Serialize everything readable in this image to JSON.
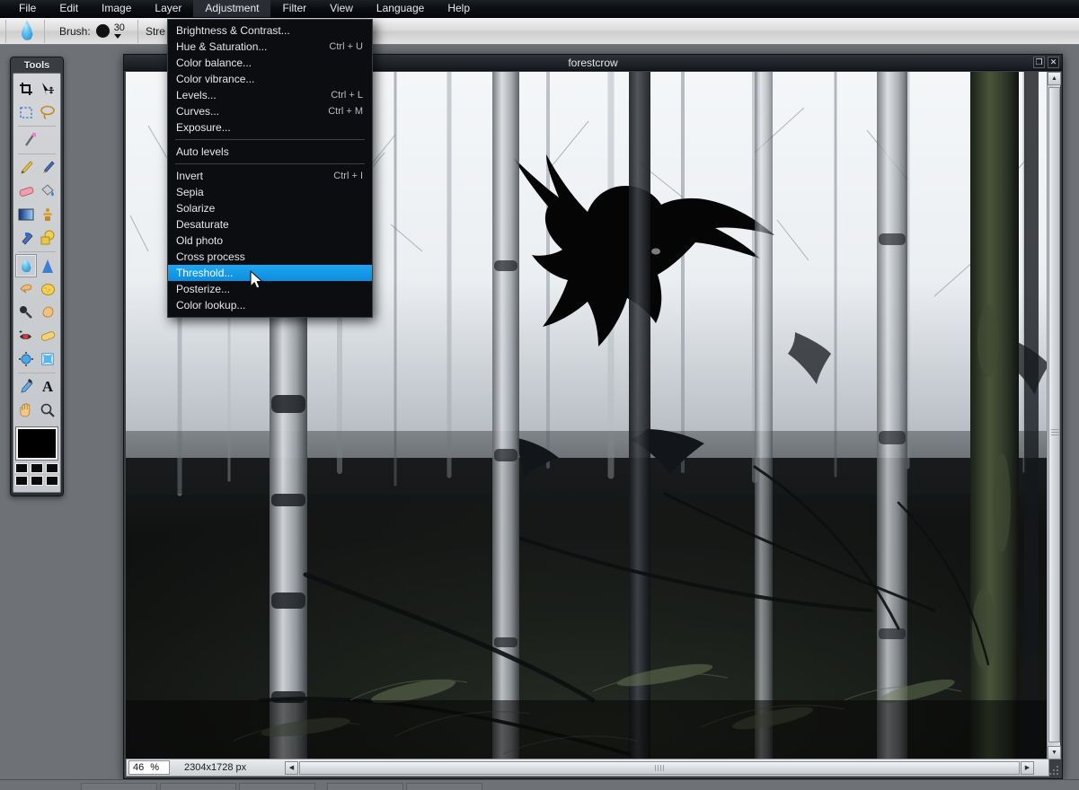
{
  "app": {
    "menubar": [
      {
        "label": "File",
        "open": false
      },
      {
        "label": "Edit",
        "open": false
      },
      {
        "label": "Image",
        "open": false
      },
      {
        "label": "Layer",
        "open": false
      },
      {
        "label": "Adjustment",
        "open": true
      },
      {
        "label": "Filter",
        "open": false
      },
      {
        "label": "View",
        "open": false
      },
      {
        "label": "Language",
        "open": false
      },
      {
        "label": "Help",
        "open": false
      }
    ]
  },
  "options_bar": {
    "active_tool_icon": "water-drop-icon",
    "brush_label": "Brush:",
    "brush_size": "30",
    "strength_label": "Stre"
  },
  "tools_panel": {
    "title": "Tools",
    "rows": [
      [
        {
          "name": "crop-tool",
          "glyph": "⌗"
        },
        {
          "name": "move-tool",
          "glyph": "➤"
        }
      ],
      [
        {
          "name": "rectangular-select-tool",
          "glyph": "▭"
        },
        {
          "name": "lasso-tool",
          "glyph": "◯"
        }
      ],
      [
        {
          "name": "magic-wand-tool",
          "glyph": "✦"
        }
      ],
      [
        {
          "name": "pencil-tool",
          "glyph": "✏"
        },
        {
          "name": "paintbrush-tool",
          "glyph": "🖌"
        }
      ],
      [
        {
          "name": "eraser-tool",
          "glyph": "▰"
        },
        {
          "name": "paint-bucket-tool",
          "glyph": "🪣"
        }
      ],
      [
        {
          "name": "gradient-tool",
          "glyph": "▤"
        },
        {
          "name": "clone-stamp-tool",
          "glyph": "♟"
        }
      ],
      [
        {
          "name": "smudge-tool",
          "glyph": "✒"
        },
        {
          "name": "shape-tool",
          "glyph": "⬟"
        }
      ],
      [
        {
          "name": "blur-tool",
          "glyph": "💧",
          "selected": true
        },
        {
          "name": "sharpen-tool",
          "glyph": "▲"
        }
      ],
      [
        {
          "name": "dodge-tool",
          "glyph": "☞"
        },
        {
          "name": "sponge-tool",
          "glyph": "⬤"
        }
      ],
      [
        {
          "name": "burn-tool",
          "glyph": "🔍"
        },
        {
          "name": "pinch-tool",
          "glyph": "✋"
        }
      ],
      [
        {
          "name": "red-eye-tool",
          "glyph": "◉"
        },
        {
          "name": "bandage-tool",
          "glyph": "▬"
        }
      ],
      [
        {
          "name": "bloat-tool",
          "glyph": "✥"
        },
        {
          "name": "warp-tool",
          "glyph": "✧"
        }
      ],
      [
        {
          "name": "eyedropper-tool",
          "glyph": "✎"
        },
        {
          "name": "text-tool",
          "glyph": "A"
        }
      ],
      [
        {
          "name": "hand-tool",
          "glyph": "✋"
        },
        {
          "name": "zoom-tool",
          "glyph": "🔎"
        }
      ]
    ],
    "foreground_color": "#000000",
    "palette_colors": [
      "#0a0a0a",
      "#0a0a0a",
      "#0a0a0a",
      "#0a0a0a",
      "#0a0a0a",
      "#0a0a0a"
    ]
  },
  "document_window": {
    "title": "forestcrow",
    "maximize_label": "❐",
    "close_label": "✕",
    "status": {
      "zoom_value": "46",
      "zoom_unit": "%",
      "dimensions": "2304x1728 px"
    }
  },
  "adjustment_menu": {
    "items": [
      {
        "label": "Brightness & Contrast...",
        "accel": "",
        "highlighted": false,
        "separator_after": false
      },
      {
        "label": "Hue & Saturation...",
        "accel": "Ctrl + U",
        "highlighted": false,
        "separator_after": false
      },
      {
        "label": "Color balance...",
        "accel": "",
        "highlighted": false,
        "separator_after": false
      },
      {
        "label": "Color vibrance...",
        "accel": "",
        "highlighted": false,
        "separator_after": false
      },
      {
        "label": "Levels...",
        "accel": "Ctrl + L",
        "highlighted": false,
        "separator_after": false
      },
      {
        "label": "Curves...",
        "accel": "Ctrl + M",
        "highlighted": false,
        "separator_after": false
      },
      {
        "label": "Exposure...",
        "accel": "",
        "highlighted": false,
        "separator_after": true
      },
      {
        "label": "Auto levels",
        "accel": "",
        "highlighted": false,
        "separator_after": true
      },
      {
        "label": "Invert",
        "accel": "Ctrl + I",
        "highlighted": false,
        "separator_after": false
      },
      {
        "label": "Sepia",
        "accel": "",
        "highlighted": false,
        "separator_after": false
      },
      {
        "label": "Solarize",
        "accel": "",
        "highlighted": false,
        "separator_after": false
      },
      {
        "label": "Desaturate",
        "accel": "",
        "highlighted": false,
        "separator_after": false
      },
      {
        "label": "Old photo",
        "accel": "",
        "highlighted": false,
        "separator_after": false
      },
      {
        "label": "Cross process",
        "accel": "",
        "highlighted": false,
        "separator_after": false
      },
      {
        "label": "Threshold...",
        "accel": "",
        "highlighted": true,
        "separator_after": false
      },
      {
        "label": "Posterize...",
        "accel": "",
        "highlighted": false,
        "separator_after": false
      },
      {
        "label": "Color lookup...",
        "accel": "",
        "highlighted": false,
        "separator_after": false
      }
    ],
    "highlight_color": "#1fa6f2"
  },
  "scrollbars": {
    "up_arrow": "▲",
    "down_arrow": "▼",
    "left_arrow": "◀",
    "right_arrow": "▶"
  }
}
